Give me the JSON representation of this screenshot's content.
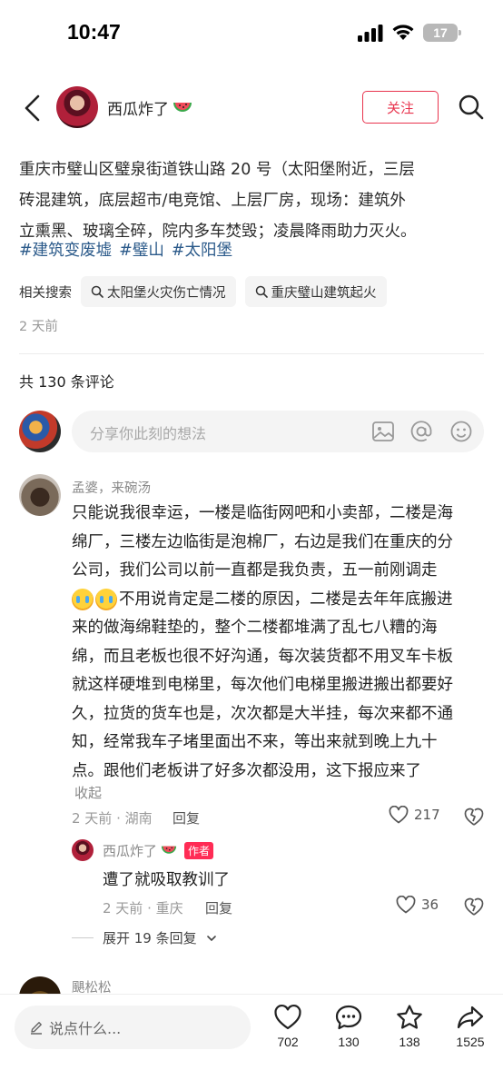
{
  "status_bar": {
    "time": "10:47",
    "battery": "17"
  },
  "nav": {
    "author_name": "西瓜炸了",
    "follow_label": "关注"
  },
  "post": {
    "lines": [
      "重庆市璧山区璧泉街道铁山路 20 号（太阳堡附近，三层",
      "砖混建筑，底层超市/电竞馆、上层厂房，现场：建筑外",
      "立熏黑、玻璃全碎，院内多车焚毁；凌晨降雨助力灭火。"
    ],
    "tags": [
      "#建筑变废墟",
      "#璧山",
      "#太阳堡"
    ],
    "related_label": "相关搜索",
    "related": [
      "太阳堡火灾伤亡情况",
      "重庆璧山建筑起火"
    ],
    "time_ago": "2 天前"
  },
  "comments_header": {
    "count_text": "共 130 条评论"
  },
  "composer": {
    "placeholder": "分享你此刻的想法"
  },
  "comment": {
    "user": "孟婆，来碗汤",
    "lines": [
      "只能说我很幸运，一楼是临街网吧和小卖部，二楼是海",
      "绵厂，三楼左边临街是泡棉厂，右边是我们在重庆的分",
      "公司，我们公司以前一直都是我负责，五一前刚调走",
      "不用说肯定是二楼的原因，二楼是去年年底搬进",
      "来的做海绵鞋垫的，整个二楼都堆满了乱七八糟的海",
      "绵，而且老板也很不好沟通，每次装货都不用叉车卡板",
      "就这样硬堆到电梯里，每次他们电梯里搬进搬出都要好",
      "久，拉货的货车也是，次次都是大半挂，每次来都不通",
      "知，经常我车子堵里面出不来，等出来就到晚上九十",
      "点。跟他们老板讲了好多次都没用，这下报应来了"
    ],
    "collapse": "收起",
    "meta": "2 天前 · 湖南",
    "reply": "回复",
    "likes": "217"
  },
  "reply_comment": {
    "user": "西瓜炸了",
    "badge": "作者",
    "text": "遭了就吸取教训了",
    "meta": "2 天前 · 重庆",
    "reply": "回复",
    "likes": "36"
  },
  "expand": {
    "label": "展开 19 条回复"
  },
  "next_comment": {
    "user": "颶松松"
  },
  "bottom_bar": {
    "placeholder": "说点什么...",
    "likes": "702",
    "comments": "130",
    "stars": "138",
    "shares": "1525"
  }
}
